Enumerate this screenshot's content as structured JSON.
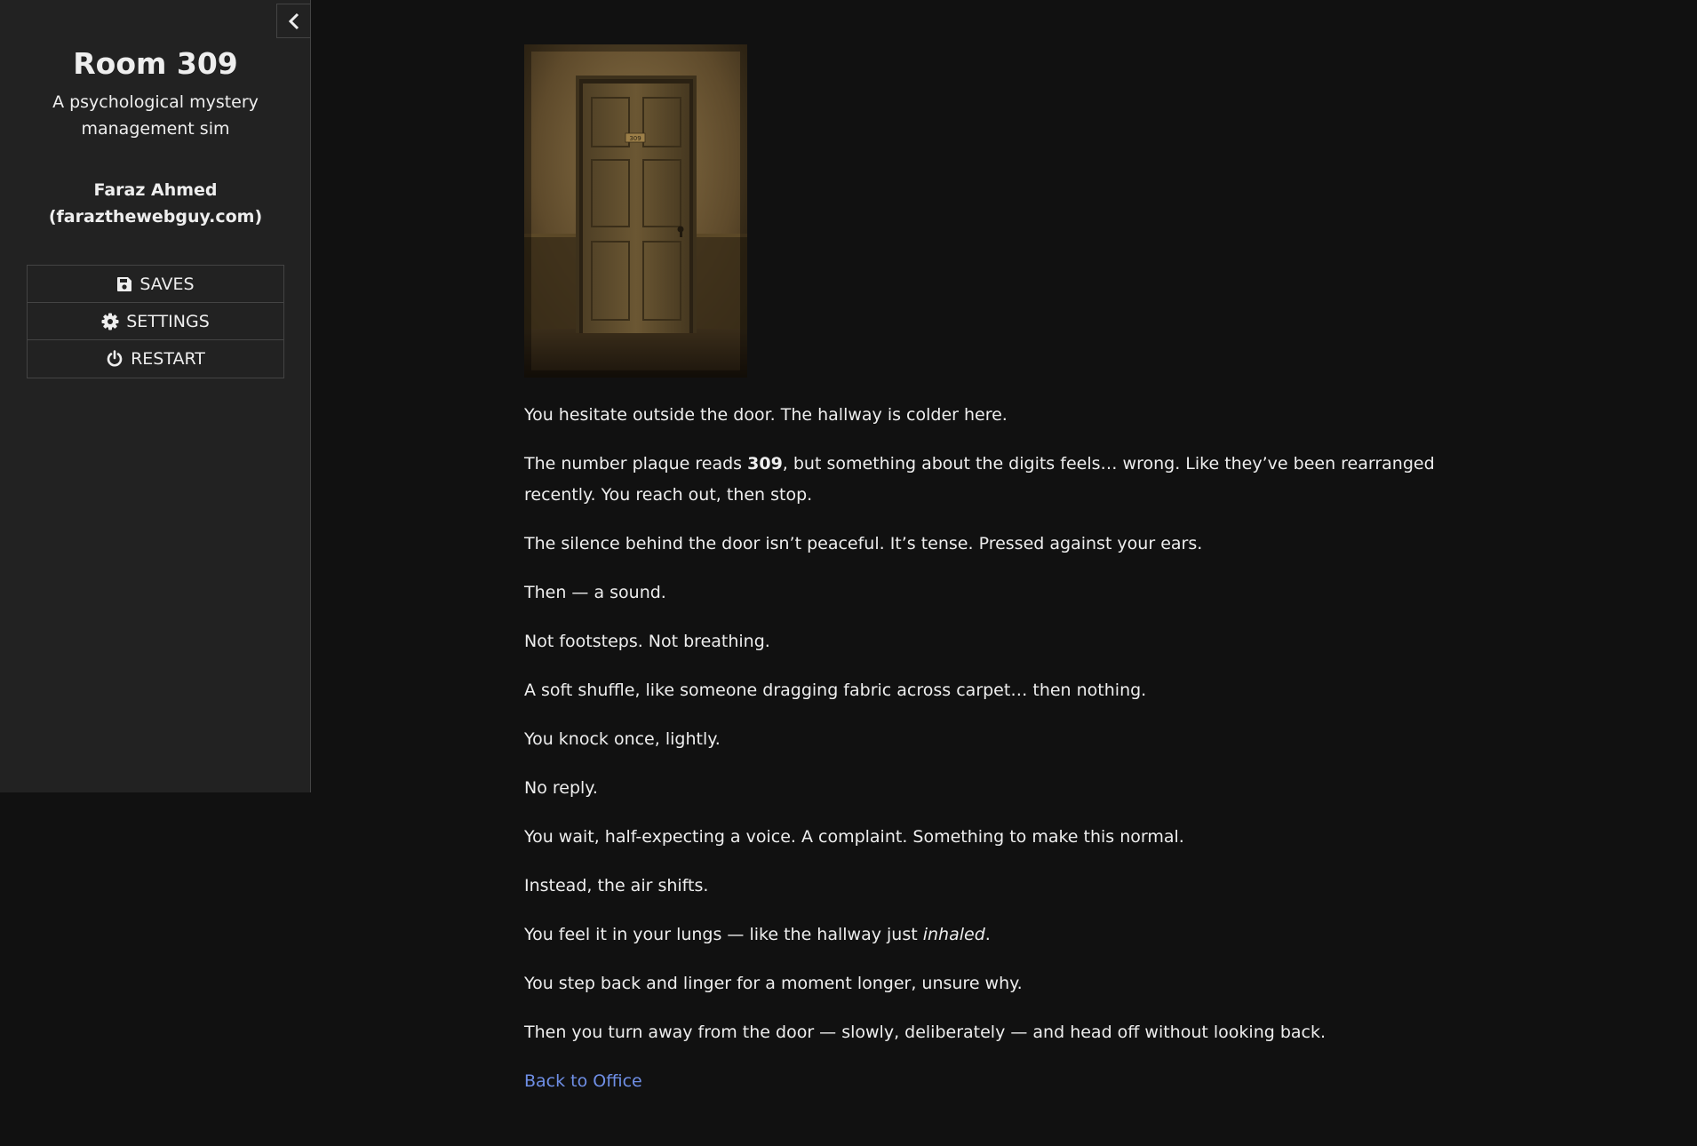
{
  "sidebar": {
    "title": "Room 309",
    "subtitle": "A psychological mystery management sim",
    "author": "Faraz Ahmed (farazthewebguy.com)",
    "menu": [
      {
        "label": "SAVES",
        "icon": "floppy-disk-icon"
      },
      {
        "label": "SETTINGS",
        "icon": "gear-icon"
      },
      {
        "label": "RESTART",
        "icon": "power-icon"
      }
    ],
    "toggle_icon": "chevron-left-icon"
  },
  "passage": {
    "image": {
      "door_plaque": "309"
    },
    "p1": "You hesitate outside the door. The hallway is colder here.",
    "p2_before": "The number plaque reads ",
    "p2_bold": "309",
    "p2_after": ", but something about the digits feels… wrong. Like they’ve been rearranged recently. You reach out, then stop.",
    "p3": "The silence behind the door isn’t peaceful. It’s tense. Pressed against your ears.",
    "p4": "Then — a sound.",
    "p5": "Not footsteps. Not breathing.",
    "p6": "A soft shuffle, like someone dragging fabric across carpet… then nothing.",
    "p7": "You knock once, lightly.",
    "p8": "No reply.",
    "p9": "You wait, half-expecting a voice. A complaint. Something to make this normal.",
    "p10": "Instead, the air shifts.",
    "p11_before": "You feel it in your lungs — like the hallway just ",
    "p11_italic": "inhaled",
    "p11_after": ".",
    "p12": "You step back and linger for a moment longer, unsure why.",
    "p13": "Then you turn away from the door — slowly, deliberately — and head off without looking back.",
    "link": "Back to Office"
  },
  "colors": {
    "background": "#111111",
    "sidebar": "#222222",
    "text": "#eeeeee",
    "link": "#6f8fe6",
    "border": "#444444"
  }
}
